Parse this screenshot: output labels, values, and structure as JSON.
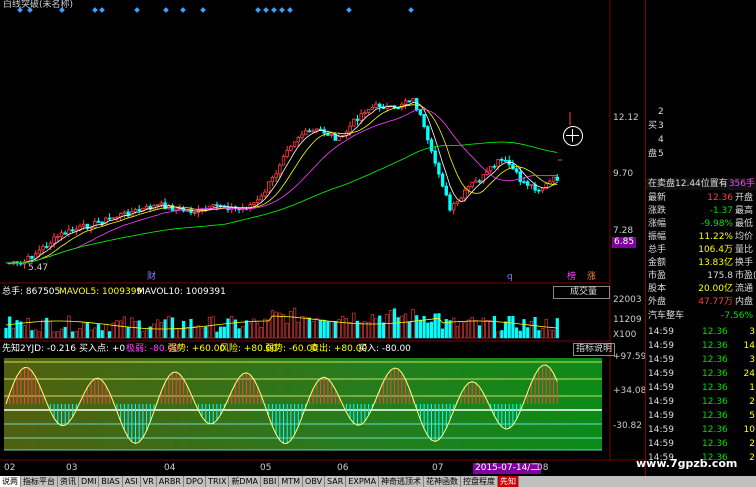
{
  "window": {
    "title": "白线突破(未名称)"
  },
  "price_axis": [
    "12.12",
    "9.70",
    "7.28",
    "6.85"
  ],
  "price_min_label": "5.47",
  "markers": {
    "cai": "财",
    "q": "q",
    "jing": "榜",
    "zhang": "涨"
  },
  "volume_header": {
    "total": "总手: 867505",
    "mavol5": "MAVOL5: 1009399",
    "mavol10": "MAVOL10: 1009391",
    "dropdown": "成交量"
  },
  "volume_axis": [
    "22003",
    "11209",
    "X100"
  ],
  "indicator_header": {
    "name": "先知2",
    "items": [
      "YJD: -0.216",
      "买入点: +0",
      "极弱: -80.00",
      "强势: +60.00",
      "风险: +80.00",
      "弱势: -60.00",
      "卖出: +80.00",
      "买入: -80.00"
    ],
    "help": "指标说明"
  },
  "indicator_axis": [
    "+97.59",
    "+34.08",
    "-30.82"
  ],
  "date_axis": [
    "02",
    "03",
    "04",
    "05",
    "06",
    "07",
    "08"
  ],
  "date_highlight": "2015-07-14/二",
  "quote": {
    "ask_labels": [
      "2",
      "3",
      "4",
      "5"
    ],
    "side_labels": [
      "买",
      "盘"
    ],
    "status": "在卖盘12.44位置有",
    "status_count": "356手",
    "rows": [
      {
        "label": "最新",
        "value": "12.36",
        "label2": "开盘",
        "color": "#ff4040"
      },
      {
        "label": "涨跌",
        "value": "-1.37",
        "label2": "最高",
        "color": "#00e000"
      },
      {
        "label": "涨幅",
        "value": "-9.98%",
        "label2": "最低",
        "color": "#00e000"
      },
      {
        "label": "振幅",
        "value": "11.22%",
        "label2": "均价",
        "color": "#ffff00"
      },
      {
        "label": "总手",
        "value": "106.4万",
        "label2": "量比",
        "color": "#ffff00"
      },
      {
        "label": "金额",
        "value": "13.83亿",
        "label2": "换手",
        "color": "#ffff00"
      },
      {
        "label": "市盈",
        "value": "175.8",
        "label2": "市盈(动)",
        "color": "#ddd"
      },
      {
        "label": "股本",
        "value": "20.00亿",
        "label2": "流通",
        "color": "#ffff00"
      },
      {
        "label": "外盘",
        "value": "47.77万",
        "label2": "内盘",
        "color": "#ff4040"
      }
    ],
    "sector": "汽车整车",
    "sector_change": "-7.56%",
    "ticks": [
      {
        "time": "14:59",
        "price": "12.36",
        "vol": "3"
      },
      {
        "time": "14:59",
        "price": "12.36",
        "vol": "14"
      },
      {
        "time": "14:59",
        "price": "12.36",
        "vol": "3"
      },
      {
        "time": "14:59",
        "price": "12.36",
        "vol": "24"
      },
      {
        "time": "14:59",
        "price": "12.36",
        "vol": "1"
      },
      {
        "time": "14:59",
        "price": "12.36",
        "vol": "2"
      },
      {
        "time": "14:59",
        "price": "12.36",
        "vol": "5"
      },
      {
        "time": "14:59",
        "price": "12.36",
        "vol": "10"
      },
      {
        "time": "14:59",
        "price": "12.36",
        "vol": "2"
      },
      {
        "time": "14:59",
        "price": "12.36",
        "vol": "2"
      }
    ]
  },
  "bottom_tabs": [
    "说两",
    "指标平台",
    "资讯",
    "DMI",
    "BIAS",
    "ASI",
    "VR",
    "ARBR",
    "DPO",
    "TRIX",
    "新DMA",
    "BBI",
    "MTM",
    "OBV",
    "SAR",
    "EXPMA",
    "神奇逃顶术",
    "花神函数",
    "控盘程度",
    "先知"
  ],
  "watermark": "www.7gpzb.com",
  "colors": {
    "up": "#ff4040",
    "down": "#00ffff",
    "panel_border": "#800000",
    "green_band": "#1b8a1b"
  }
}
